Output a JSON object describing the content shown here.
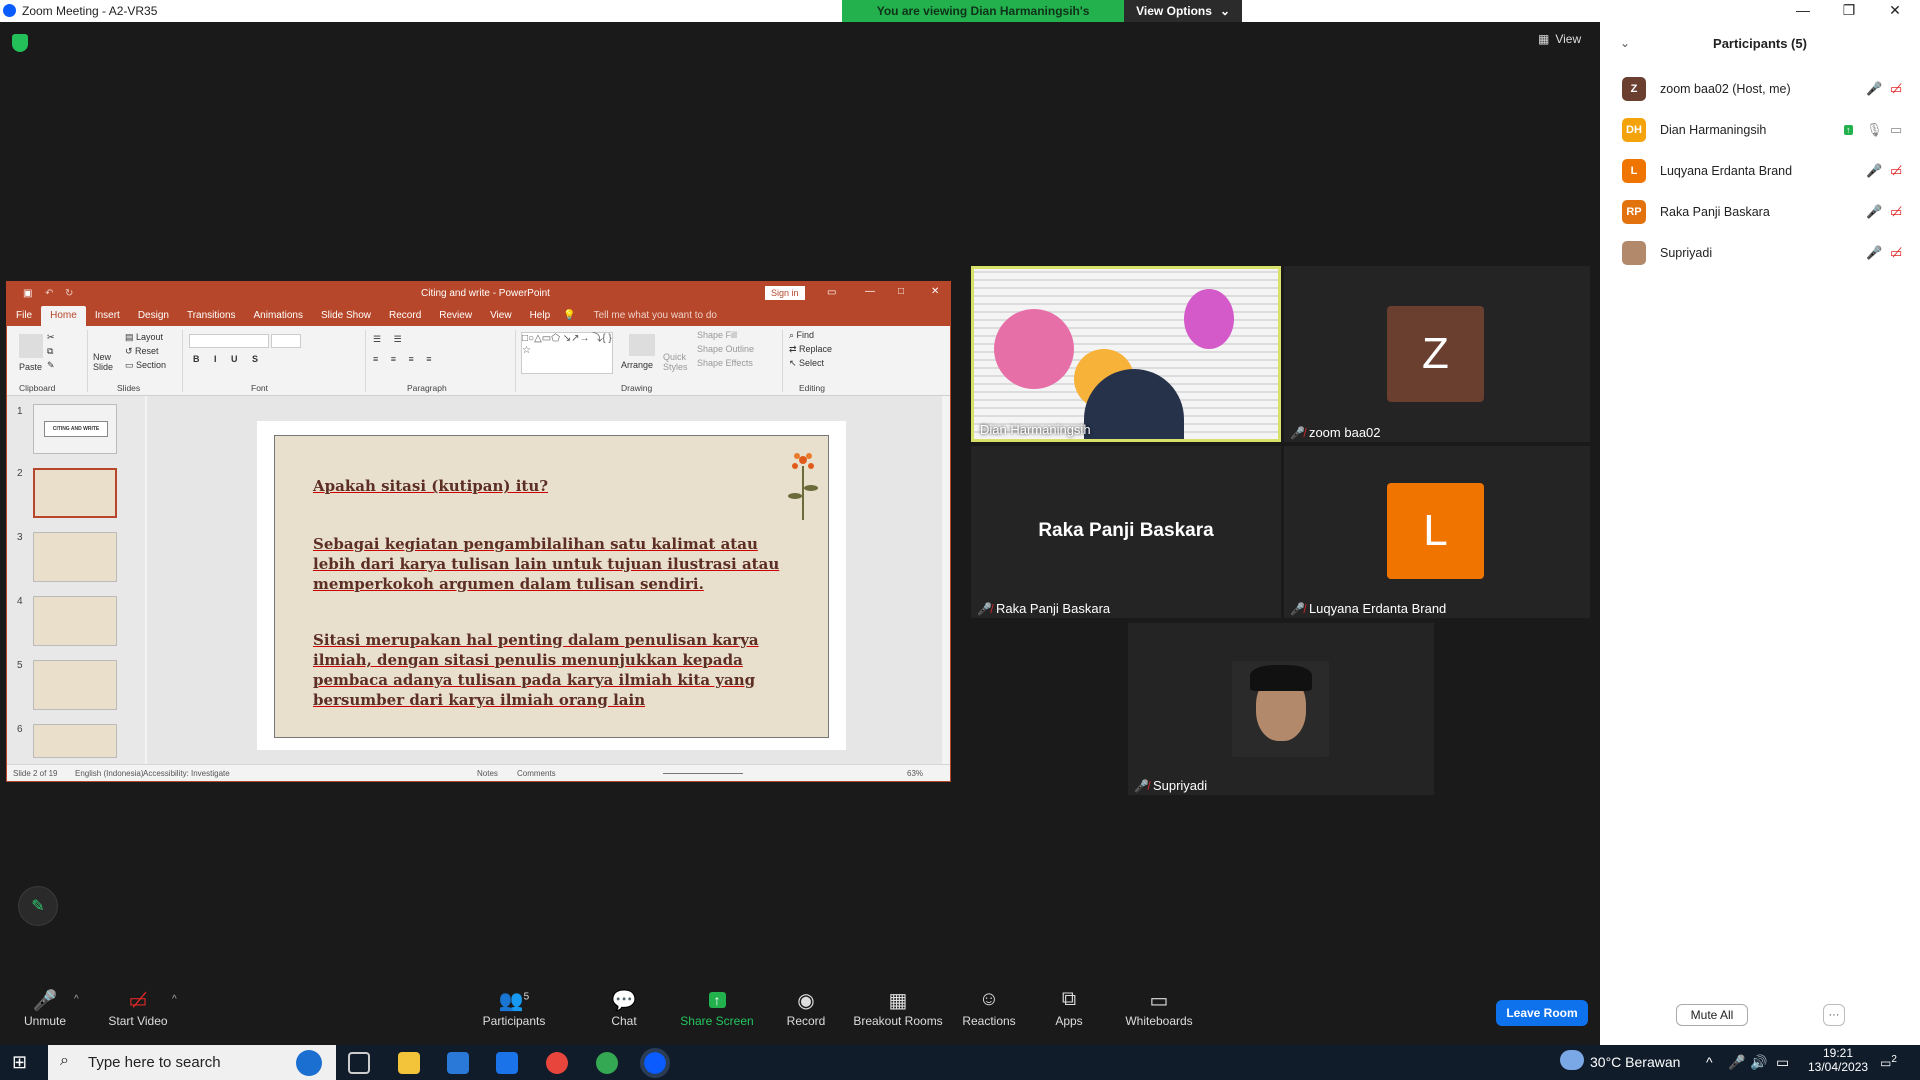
{
  "window": {
    "title": "Zoom Meeting - A2-VR35"
  },
  "share_banner": {
    "message": "You are viewing Dian Harmaningsih's screen",
    "view_options": "View Options"
  },
  "view_button": {
    "label": "View"
  },
  "ppt": {
    "title": "Citing and write  -  PowerPoint",
    "sign_in": "Sign in",
    "tabs": [
      "File",
      "Home",
      "Insert",
      "Design",
      "Transitions",
      "Animations",
      "Slide Show",
      "Record",
      "Review",
      "View",
      "Help"
    ],
    "tell_me": "Tell me what you want to do",
    "ribbon": {
      "paste": "Paste",
      "new_slide": "New\nSlide",
      "layout": "Layout",
      "reset": "Reset",
      "section": "Section",
      "arrange": "Arrange",
      "quick_styles": "Quick\nStyles",
      "shape_fill": "Shape Fill",
      "shape_outline": "Shape Outline",
      "shape_effects": "Shape Effects",
      "find": "Find",
      "replace": "Replace",
      "select": "Select",
      "groups": [
        "Clipboard",
        "Slides",
        "Font",
        "Paragraph",
        "Drawing",
        "Editing"
      ]
    },
    "thumb_numbers": [
      "1",
      "2",
      "3",
      "4",
      "5",
      "6"
    ],
    "thumb1_title": "CITING AND WRITE",
    "slide": {
      "heading": "Apakah sitasi (kutipan) itu?",
      "para1": "Sebagai kegiatan pengambilalihan satu kalimat atau lebih dari karya tulisan lain untuk tujuan ilustrasi atau memperkokoh argumen dalam tulisan sendiri.",
      "para2": "Sitasi merupakan hal penting dalam penulisan karya ilmiah, dengan sitasi penulis menunjukkan kepada pembaca adanya tulisan pada karya ilmiah kita yang bersumber dari karya ilmiah orang lain"
    },
    "status": {
      "slide": "Slide 2 of 19",
      "language": "English (Indonesia)",
      "accessibility": "Accessibility: Investigate",
      "notes": "Notes",
      "comments": "Comments",
      "zoom": "63%"
    }
  },
  "tiles": {
    "dian": "Dian Harmaningsih",
    "zoom": "zoom baa02",
    "zoom_initial": "Z",
    "raka_big": "Raka Panji Baskara",
    "raka": "Raka Panji Baskara",
    "luqyana": "Luqyana Erdanta Brand",
    "luqyana_initial": "L",
    "supriyadi": "Supriyadi"
  },
  "participants": {
    "header": "Participants (5)",
    "list": [
      {
        "initials": "Z",
        "name": "zoom baa02 (Host, me)",
        "color": "#6b3f30"
      },
      {
        "initials": "DH",
        "name": "Dian Harmaningsih",
        "color": "#f5a30a"
      },
      {
        "initials": "L",
        "name": "Luqyana Erdanta Brand",
        "color": "#f07400"
      },
      {
        "initials": "RP",
        "name": "Raka Panji Baskara",
        "color": "#e2720d"
      },
      {
        "initials": "",
        "name": "Supriyadi",
        "color": "#333333"
      }
    ],
    "mute_all": "Mute All",
    "more": "···"
  },
  "toolbar": {
    "unmute": "Unmute",
    "start_video": "Start Video",
    "participants": "Participants",
    "participants_count": "5",
    "chat": "Chat",
    "share_screen": "Share Screen",
    "record": "Record",
    "breakout": "Breakout Rooms",
    "reactions": "Reactions",
    "apps": "Apps",
    "whiteboards": "Whiteboards",
    "leave": "Leave Room"
  },
  "taskbar": {
    "search_placeholder": "Type here to search",
    "weather": "30°C  Berawan",
    "time": "19:21",
    "date": "13/04/2023",
    "notif": "2"
  }
}
